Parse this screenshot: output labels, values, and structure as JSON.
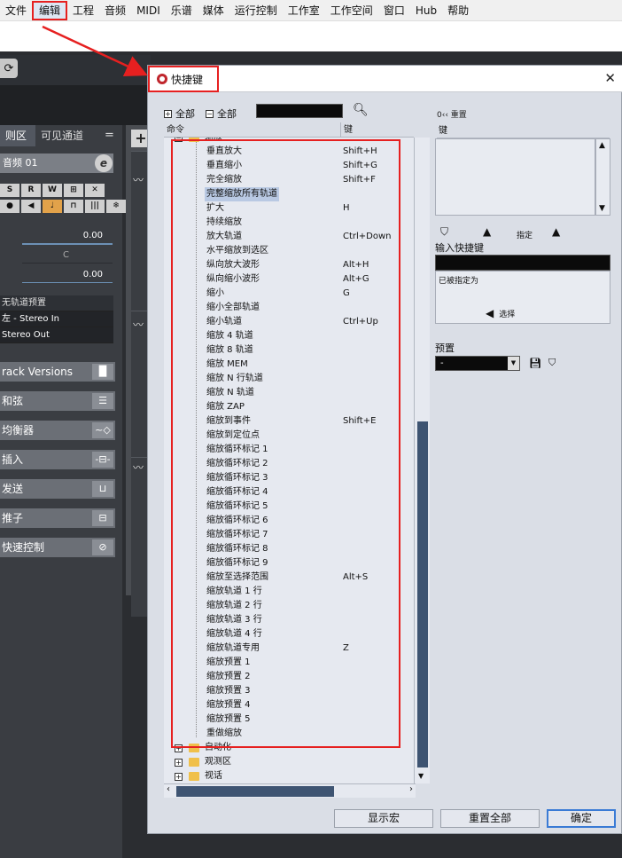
{
  "menu": [
    "文件",
    "编辑",
    "工程",
    "音频",
    "MIDI",
    "乐谱",
    "媒体",
    "运行控制",
    "工作室",
    "工作空间",
    "窗口",
    "Hub",
    "帮助"
  ],
  "inspector": {
    "tab_left": "则区",
    "tab_right": "可见通道",
    "tab_menu": "=",
    "track_name": "音频 01",
    "track_edit": "e",
    "row1": [
      "S",
      "R",
      "W",
      "⊞",
      "✕"
    ],
    "row2": [
      "●",
      "◀",
      "♩",
      "⊓",
      "|||",
      "❄"
    ],
    "fader1_value": "0.00",
    "pan_label": "C",
    "fader3_value": "0.00",
    "route_preset": "无轨道预置",
    "route_in": "左 - Stereo In",
    "route_out": "Stereo Out",
    "sections": [
      {
        "label": "rack Versions",
        "icon": "▐▌"
      },
      {
        "label": "和弦",
        "icon": "☰"
      },
      {
        "label": "均衡器",
        "icon": "~◇"
      },
      {
        "label": "插入",
        "icon": "-⊟-"
      },
      {
        "label": "发送",
        "icon": "⊔"
      },
      {
        "label": "推子",
        "icon": "⊟"
      },
      {
        "label": "快速控制",
        "icon": "⊘"
      }
    ]
  },
  "dialog": {
    "title": "快捷键",
    "close": "✕",
    "expand_all": "全部",
    "collapse_all": "全部",
    "col_command": "命令",
    "col_key": "键",
    "tree_parent": "缩放",
    "commands": [
      {
        "cmd": "垂直放大",
        "key": "Shift+H"
      },
      {
        "cmd": "垂直缩小",
        "key": "Shift+G"
      },
      {
        "cmd": "完全缩放",
        "key": "Shift+F"
      },
      {
        "cmd": "完整缩放所有轨道",
        "key": ""
      },
      {
        "cmd": "扩大",
        "key": "H"
      },
      {
        "cmd": "持续缩放",
        "key": ""
      },
      {
        "cmd": "放大轨道",
        "key": "Ctrl+Down"
      },
      {
        "cmd": "水平缩放到选区",
        "key": ""
      },
      {
        "cmd": "纵向放大波形",
        "key": "Alt+H"
      },
      {
        "cmd": "纵向缩小波形",
        "key": "Alt+G"
      },
      {
        "cmd": "缩小",
        "key": "G"
      },
      {
        "cmd": "缩小全部轨道",
        "key": ""
      },
      {
        "cmd": "缩小轨道",
        "key": "Ctrl+Up"
      },
      {
        "cmd": "缩放 4 轨道",
        "key": ""
      },
      {
        "cmd": "缩放 8 轨道",
        "key": ""
      },
      {
        "cmd": "缩放 MEM",
        "key": ""
      },
      {
        "cmd": "缩放 N 行轨道",
        "key": ""
      },
      {
        "cmd": "缩放 N 轨道",
        "key": ""
      },
      {
        "cmd": "缩放 ZAP",
        "key": ""
      },
      {
        "cmd": "缩放到事件",
        "key": "Shift+E"
      },
      {
        "cmd": "缩放到定位点",
        "key": ""
      },
      {
        "cmd": "缩放循环标记 1",
        "key": ""
      },
      {
        "cmd": "缩放循环标记 2",
        "key": ""
      },
      {
        "cmd": "缩放循环标记 3",
        "key": ""
      },
      {
        "cmd": "缩放循环标记 4",
        "key": ""
      },
      {
        "cmd": "缩放循环标记 5",
        "key": ""
      },
      {
        "cmd": "缩放循环标记 6",
        "key": ""
      },
      {
        "cmd": "缩放循环标记 7",
        "key": ""
      },
      {
        "cmd": "缩放循环标记 8",
        "key": ""
      },
      {
        "cmd": "缩放循环标记 9",
        "key": ""
      },
      {
        "cmd": "缩放至选择范围",
        "key": "Alt+S"
      },
      {
        "cmd": "缩放轨道 1 行",
        "key": ""
      },
      {
        "cmd": "缩放轨道 2 行",
        "key": ""
      },
      {
        "cmd": "缩放轨道 3 行",
        "key": ""
      },
      {
        "cmd": "缩放轨道 4 行",
        "key": ""
      },
      {
        "cmd": "缩放轨道专用",
        "key": "Z"
      },
      {
        "cmd": "缩放预置 1",
        "key": ""
      },
      {
        "cmd": "缩放预置 2",
        "key": ""
      },
      {
        "cmd": "缩放预置 3",
        "key": ""
      },
      {
        "cmd": "缩放预置 4",
        "key": ""
      },
      {
        "cmd": "缩放预置 5",
        "key": ""
      },
      {
        "cmd": "重做缩放",
        "key": ""
      }
    ],
    "folders_after": [
      "自动化",
      "观测区",
      "视话"
    ],
    "right": {
      "top_label": "0‹‹ 重置",
      "key_header": "键",
      "assign_label": "指定",
      "input_label": "输入快捷键",
      "assigned_to": "已被指定为",
      "select_label": "选择",
      "preset_label": "预置",
      "preset_value": "-"
    },
    "buttons": {
      "show_macros": "显示宏",
      "reset_all": "重置全部",
      "ok": "确定"
    }
  },
  "colors": {
    "annotation_red": "#e62020",
    "selection_blue": "#3e5472"
  }
}
